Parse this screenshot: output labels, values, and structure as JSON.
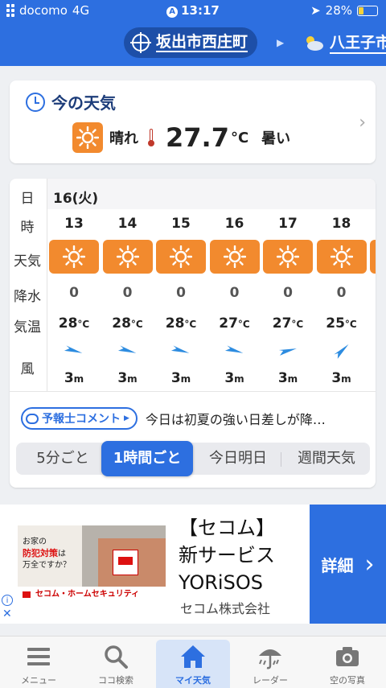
{
  "status": {
    "carrier": "docomo",
    "network": "4G",
    "time": "13:17",
    "battery": "28%"
  },
  "header": {
    "location": "坂出市西庄町",
    "next_location": "八王子市"
  },
  "now": {
    "title": "今の天気",
    "condition": "晴れ",
    "temperature": "27.7",
    "unit": "°C",
    "description": "暑い"
  },
  "hourly": {
    "labels": {
      "day": "日",
      "hour": "時",
      "weather": "天気",
      "rain": "降水",
      "temp": "気温",
      "wind": "風"
    },
    "day": "16(火)",
    "hours": [
      {
        "hour": "13",
        "rain": "0",
        "temp": "28",
        "wind_speed": "3",
        "wind_dir_deg": 20
      },
      {
        "hour": "14",
        "rain": "0",
        "temp": "28",
        "wind_speed": "3",
        "wind_dir_deg": 20
      },
      {
        "hour": "15",
        "rain": "0",
        "temp": "28",
        "wind_speed": "3",
        "wind_dir_deg": 20
      },
      {
        "hour": "16",
        "rain": "0",
        "temp": "27",
        "wind_speed": "3",
        "wind_dir_deg": 20
      },
      {
        "hour": "17",
        "rain": "0",
        "temp": "27",
        "wind_speed": "3",
        "wind_dir_deg": -10
      },
      {
        "hour": "18",
        "rain": "0",
        "temp": "25",
        "wind_speed": "3",
        "wind_dir_deg": -40
      }
    ],
    "temp_unit": "°C",
    "wind_unit": "m",
    "comment_badge": "予報士コメント",
    "comment_text": "今日は初夏の強い日差しが降…",
    "tabs": [
      "5分ごと",
      "1時間ごと",
      "今日明日",
      "週間天気"
    ],
    "active_tab": "1時間ごと"
  },
  "ad": {
    "image_copy_1": "お家の",
    "image_copy_2": "防犯対策",
    "image_copy_3": "は",
    "image_copy_4": "万全ですか？",
    "image_footer": "セコム・ホームセキュリティ",
    "title_1": "【セコム】",
    "title_2": "新サービス",
    "title_3": "YORiSOS",
    "company": "セコム株式会社",
    "button": "詳細"
  },
  "nav": [
    {
      "label": "メニュー",
      "icon": "menu-icon"
    },
    {
      "label": "ココ検索",
      "icon": "search-icon"
    },
    {
      "label": "マイ天気",
      "icon": "home-icon"
    },
    {
      "label": "レーダー",
      "icon": "radar-umbrella-icon"
    },
    {
      "label": "空の写真",
      "icon": "camera-icon"
    }
  ],
  "colors": {
    "brand": "#2d6fe0",
    "sun_tile": "#f28a2e",
    "nav_active_bg": "#d7e4f8"
  }
}
